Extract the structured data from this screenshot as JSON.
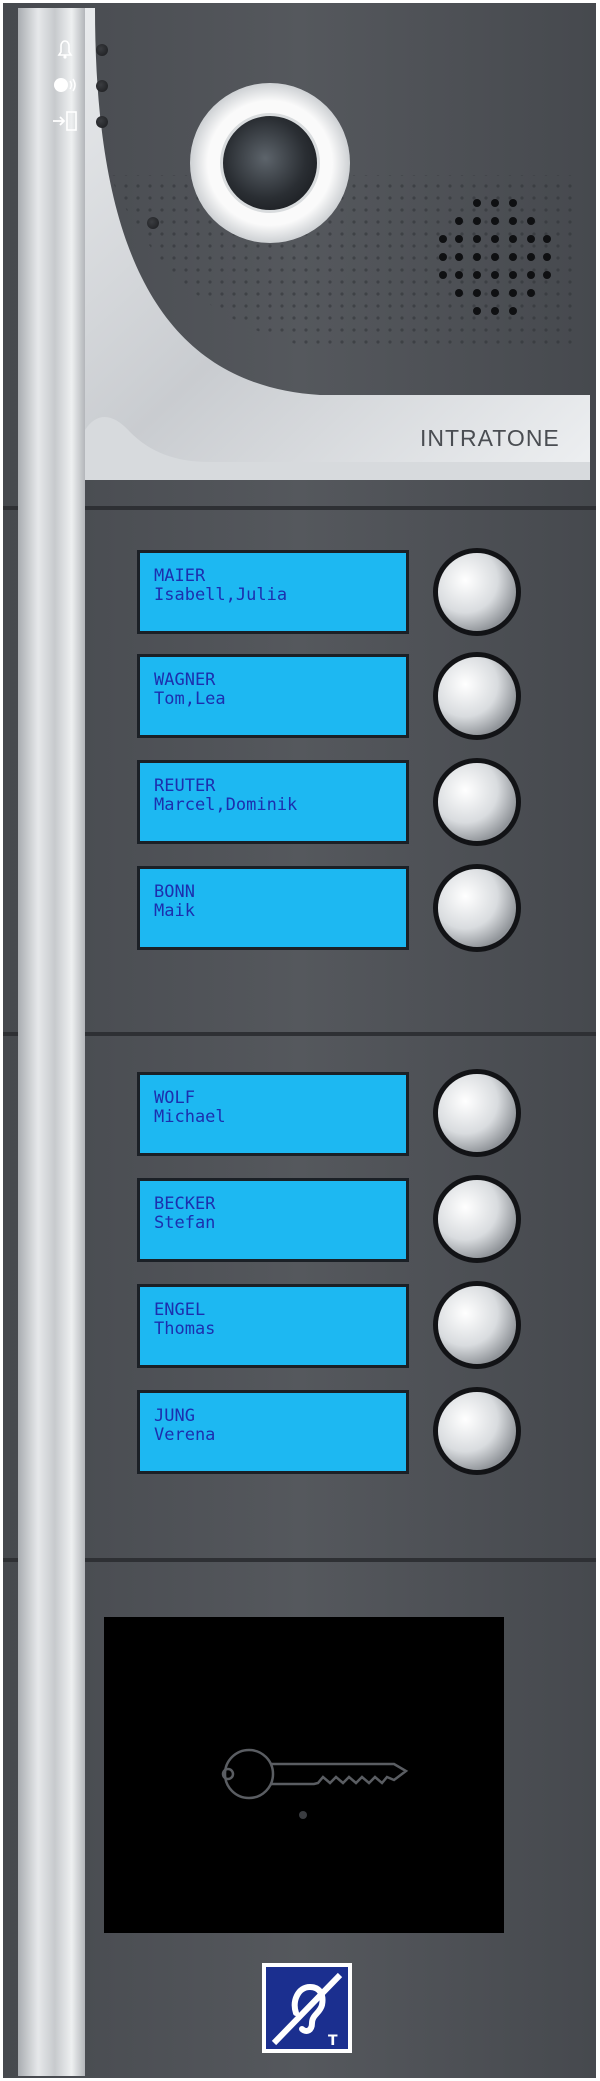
{
  "indicators": [
    {
      "icon": "bell-icon"
    },
    {
      "icon": "speaking-head-icon"
    },
    {
      "icon": "door-entry-icon"
    }
  ],
  "brand": {
    "logo_text": "INTRATONE"
  },
  "residents": [
    {
      "surname": "MAIER",
      "first_names": "Isabell,Julia"
    },
    {
      "surname": "WAGNER",
      "first_names": "Tom,Lea"
    },
    {
      "surname": "REUTER",
      "first_names": "Marcel,Dominik"
    },
    {
      "surname": "BONN",
      "first_names": "Maik"
    },
    {
      "surname": "WOLF",
      "first_names": "Michael"
    },
    {
      "surname": "BECKER",
      "first_names": "Stefan"
    },
    {
      "surname": "ENGEL",
      "first_names": "Thomas"
    },
    {
      "surname": "JUNG",
      "first_names": "Verena"
    }
  ],
  "reader": {
    "icon": "key-icon"
  },
  "accessibility": {
    "icon": "hearing-loop-icon",
    "label": "T"
  },
  "colors": {
    "panel": "#4a4d52",
    "display": "#1db8f2",
    "display_text": "#1c2fae"
  }
}
